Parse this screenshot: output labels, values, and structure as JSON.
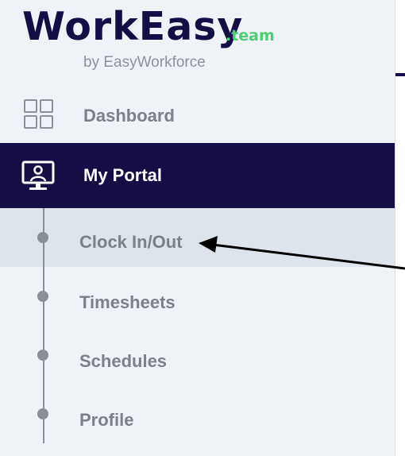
{
  "brand": {
    "name": "WorkEasy",
    "suffix": ".team",
    "byline": "by EasyWorkforce",
    "primary_color": "#150d45",
    "accent_color": "#4cce74"
  },
  "nav": {
    "dashboard": {
      "label": "Dashboard",
      "icon": "grid-icon"
    },
    "portal": {
      "label": "My Portal",
      "icon": "monitor-user-icon",
      "active": true
    }
  },
  "subnav": [
    {
      "label": "Clock In/Out",
      "active": true
    },
    {
      "label": "Timesheets",
      "active": false
    },
    {
      "label": "Schedules",
      "active": false
    },
    {
      "label": "Profile",
      "active": false
    }
  ]
}
